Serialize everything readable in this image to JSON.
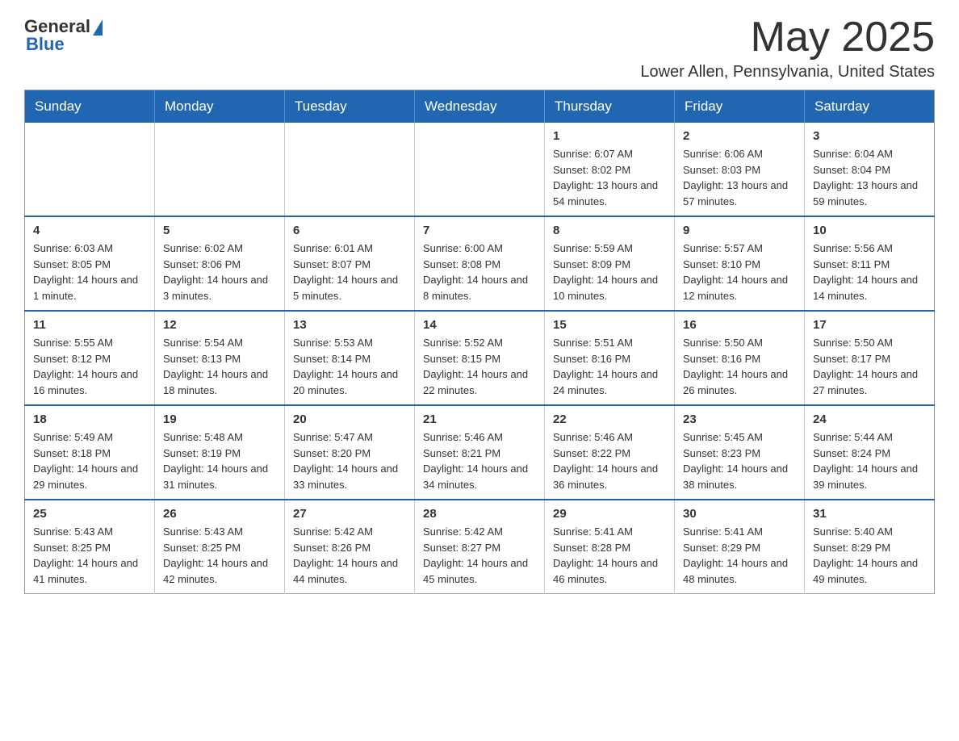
{
  "header": {
    "logo": {
      "general": "General",
      "blue": "Blue"
    },
    "month_title": "May 2025",
    "location": "Lower Allen, Pennsylvania, United States"
  },
  "days_of_week": [
    "Sunday",
    "Monday",
    "Tuesday",
    "Wednesday",
    "Thursday",
    "Friday",
    "Saturday"
  ],
  "weeks": [
    [
      {
        "day": "",
        "info": ""
      },
      {
        "day": "",
        "info": ""
      },
      {
        "day": "",
        "info": ""
      },
      {
        "day": "",
        "info": ""
      },
      {
        "day": "1",
        "info": "Sunrise: 6:07 AM\nSunset: 8:02 PM\nDaylight: 13 hours and 54 minutes."
      },
      {
        "day": "2",
        "info": "Sunrise: 6:06 AM\nSunset: 8:03 PM\nDaylight: 13 hours and 57 minutes."
      },
      {
        "day": "3",
        "info": "Sunrise: 6:04 AM\nSunset: 8:04 PM\nDaylight: 13 hours and 59 minutes."
      }
    ],
    [
      {
        "day": "4",
        "info": "Sunrise: 6:03 AM\nSunset: 8:05 PM\nDaylight: 14 hours and 1 minute."
      },
      {
        "day": "5",
        "info": "Sunrise: 6:02 AM\nSunset: 8:06 PM\nDaylight: 14 hours and 3 minutes."
      },
      {
        "day": "6",
        "info": "Sunrise: 6:01 AM\nSunset: 8:07 PM\nDaylight: 14 hours and 5 minutes."
      },
      {
        "day": "7",
        "info": "Sunrise: 6:00 AM\nSunset: 8:08 PM\nDaylight: 14 hours and 8 minutes."
      },
      {
        "day": "8",
        "info": "Sunrise: 5:59 AM\nSunset: 8:09 PM\nDaylight: 14 hours and 10 minutes."
      },
      {
        "day": "9",
        "info": "Sunrise: 5:57 AM\nSunset: 8:10 PM\nDaylight: 14 hours and 12 minutes."
      },
      {
        "day": "10",
        "info": "Sunrise: 5:56 AM\nSunset: 8:11 PM\nDaylight: 14 hours and 14 minutes."
      }
    ],
    [
      {
        "day": "11",
        "info": "Sunrise: 5:55 AM\nSunset: 8:12 PM\nDaylight: 14 hours and 16 minutes."
      },
      {
        "day": "12",
        "info": "Sunrise: 5:54 AM\nSunset: 8:13 PM\nDaylight: 14 hours and 18 minutes."
      },
      {
        "day": "13",
        "info": "Sunrise: 5:53 AM\nSunset: 8:14 PM\nDaylight: 14 hours and 20 minutes."
      },
      {
        "day": "14",
        "info": "Sunrise: 5:52 AM\nSunset: 8:15 PM\nDaylight: 14 hours and 22 minutes."
      },
      {
        "day": "15",
        "info": "Sunrise: 5:51 AM\nSunset: 8:16 PM\nDaylight: 14 hours and 24 minutes."
      },
      {
        "day": "16",
        "info": "Sunrise: 5:50 AM\nSunset: 8:16 PM\nDaylight: 14 hours and 26 minutes."
      },
      {
        "day": "17",
        "info": "Sunrise: 5:50 AM\nSunset: 8:17 PM\nDaylight: 14 hours and 27 minutes."
      }
    ],
    [
      {
        "day": "18",
        "info": "Sunrise: 5:49 AM\nSunset: 8:18 PM\nDaylight: 14 hours and 29 minutes."
      },
      {
        "day": "19",
        "info": "Sunrise: 5:48 AM\nSunset: 8:19 PM\nDaylight: 14 hours and 31 minutes."
      },
      {
        "day": "20",
        "info": "Sunrise: 5:47 AM\nSunset: 8:20 PM\nDaylight: 14 hours and 33 minutes."
      },
      {
        "day": "21",
        "info": "Sunrise: 5:46 AM\nSunset: 8:21 PM\nDaylight: 14 hours and 34 minutes."
      },
      {
        "day": "22",
        "info": "Sunrise: 5:46 AM\nSunset: 8:22 PM\nDaylight: 14 hours and 36 minutes."
      },
      {
        "day": "23",
        "info": "Sunrise: 5:45 AM\nSunset: 8:23 PM\nDaylight: 14 hours and 38 minutes."
      },
      {
        "day": "24",
        "info": "Sunrise: 5:44 AM\nSunset: 8:24 PM\nDaylight: 14 hours and 39 minutes."
      }
    ],
    [
      {
        "day": "25",
        "info": "Sunrise: 5:43 AM\nSunset: 8:25 PM\nDaylight: 14 hours and 41 minutes."
      },
      {
        "day": "26",
        "info": "Sunrise: 5:43 AM\nSunset: 8:25 PM\nDaylight: 14 hours and 42 minutes."
      },
      {
        "day": "27",
        "info": "Sunrise: 5:42 AM\nSunset: 8:26 PM\nDaylight: 14 hours and 44 minutes."
      },
      {
        "day": "28",
        "info": "Sunrise: 5:42 AM\nSunset: 8:27 PM\nDaylight: 14 hours and 45 minutes."
      },
      {
        "day": "29",
        "info": "Sunrise: 5:41 AM\nSunset: 8:28 PM\nDaylight: 14 hours and 46 minutes."
      },
      {
        "day": "30",
        "info": "Sunrise: 5:41 AM\nSunset: 8:29 PM\nDaylight: 14 hours and 48 minutes."
      },
      {
        "day": "31",
        "info": "Sunrise: 5:40 AM\nSunset: 8:29 PM\nDaylight: 14 hours and 49 minutes."
      }
    ]
  ]
}
